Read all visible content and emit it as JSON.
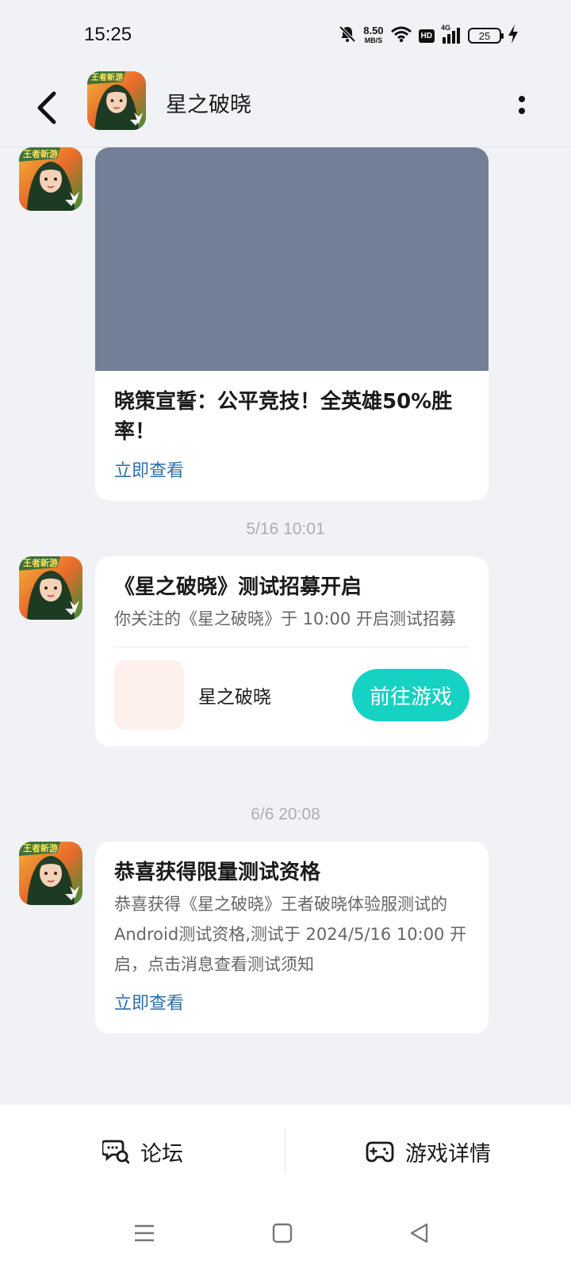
{
  "status_bar": {
    "time": "15:25",
    "net_speed": "8.50",
    "net_speed_unit": "MB/S",
    "hd_label": "HD",
    "signal_label": "4G",
    "battery": "25"
  },
  "header": {
    "title": "星之破晓"
  },
  "messages": [
    {
      "title": "晓策宣誓：公平竞技！全英雄50%胜率！",
      "link": "立即查看"
    },
    {
      "timestamp": "5/16  10:01",
      "title": "《星之破晓》测试招募开启",
      "desc": "你关注的《星之破晓》于 10:00 开启测试招募",
      "game_name": "星之破晓",
      "button": "前往游戏"
    },
    {
      "timestamp": "6/6  20:08",
      "title": "恭喜获得限量测试资格",
      "desc": "恭喜获得《星之破晓》王者破晓体验服测试的Android测试资格,测试于 2024/5/16 10:00 开启，点击消息查看测试须知",
      "link": "立即查看"
    }
  ],
  "bottom_tabs": {
    "forum": "论坛",
    "game_detail": "游戏详情"
  },
  "colors": {
    "accent": "#15d2c2",
    "link": "#2f6fa8",
    "image_placeholder": "#737f96"
  }
}
